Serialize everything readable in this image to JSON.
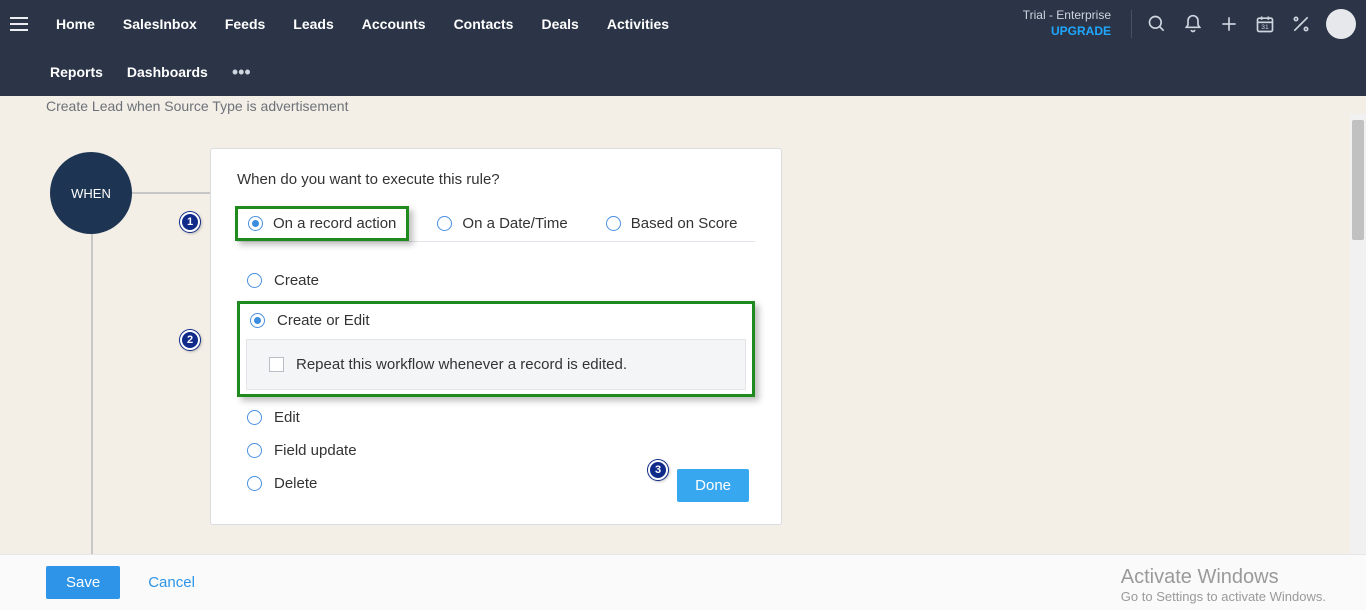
{
  "nav": {
    "row1": [
      "Home",
      "SalesInbox",
      "Feeds",
      "Leads",
      "Accounts",
      "Contacts",
      "Deals",
      "Activities"
    ],
    "row2": [
      "Reports",
      "Dashboards"
    ],
    "trial": "Trial - Enterprise",
    "upgrade": "UPGRADE"
  },
  "subtitle": "Create Lead when Source Type is advertisement",
  "node": {
    "when": "WHEN"
  },
  "panel": {
    "title": "When do you want to execute this rule?",
    "triggers": {
      "record_action": "On a record action",
      "date_time": "On a Date/Time",
      "score": "Based on Score"
    },
    "actions": {
      "create": "Create",
      "create_or_edit": "Create or Edit",
      "repeat": "Repeat this workflow whenever a record is edited.",
      "edit": "Edit",
      "field_update": "Field update",
      "delete": "Delete"
    },
    "done": "Done"
  },
  "steps": {
    "s1": "1",
    "s2": "2",
    "s3": "3"
  },
  "footer": {
    "save": "Save",
    "cancel": "Cancel"
  },
  "watermark": {
    "line1": "Activate Windows",
    "line2": "Go to Settings to activate Windows."
  }
}
